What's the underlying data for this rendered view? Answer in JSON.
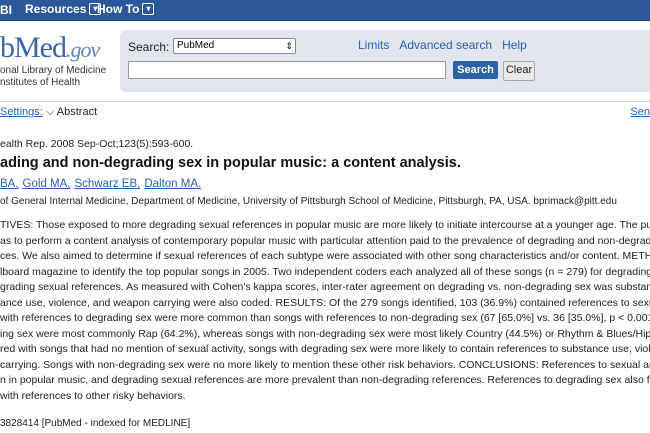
{
  "topbar": {
    "ncbi_label": "BI",
    "menus": [
      "Resources",
      "How To"
    ]
  },
  "logo": {
    "main": "bMed",
    "gov": ".gov",
    "line1": "onal Library of Medicine",
    "line2": "nstitutes of Health"
  },
  "search": {
    "label": "Search:",
    "database": "PubMed",
    "links": [
      "Limits",
      "Advanced search",
      "Help"
    ],
    "search_button": "Search",
    "clear_button": "Clear",
    "query_value": ""
  },
  "display": {
    "settings_label": "Settings:",
    "format": "Abstract",
    "send_label": "Sen"
  },
  "article": {
    "journal_line": "ealth Rep. 2008 Sep-Oct;123(5):593-600.",
    "title": "ading and non-degrading sex in popular music: a content analysis.",
    "authors": [
      "BA,",
      "Gold MA,",
      "Schwarz EB,",
      "Dalton MA."
    ],
    "affiliation": "of General Internal Medicine, Department of Medicine, University of Pittsburgh School of Medicine, Pittsburgh, PA, USA. bprimack@pitt.edu",
    "abstract_lines": [
      "TIVES: Those exposed to more degrading sexual references in popular music are more likely to initiate intercourse at a younger age. The purpos",
      "as to perform a content analysis of contemporary popular music with particular attention paid to the prevalence of degrading and non-degrading s",
      "ces. We also aimed to determine if sexual references of each subtype were associated with other song characteristics and/or content. METHODS",
      "lboard magazine to identify the top popular songs in 2005. Two independent coders each analyzed all of these songs (n = 279) for degrading and",
      "grading sexual references. As measured with Cohen's kappa scores, inter-rater agreement on degrading vs. non-degrading sex was substantial. M",
      "ance use, violence, and weapon carrying were also coded. RESULTS: Of the 279 songs identified, 103 (36.9%) contained references to sexual a",
      "with references to degrading sex were more common than songs with references to non-degrading sex (67 [65.0%] vs. 36 [35.0%], p < 0.001). So",
      "ing sex were most commonly Rap (64.2%), whereas songs with non-degrading sex were most likely Country (44.5%) or Rhythm & Blues/Hip-Hop",
      "red with songs that had no mention of sexual activity, songs with degrading sex were more likely to contain references to substance use, violence",
      "carrying. Songs with non-degrading sex were no more likely to mention these other risk behaviors. CONCLUSIONS: References to sexual activit",
      "n in popular music, and degrading sexual references are more prevalent than non-degrading references. References to degrading sex also freque",
      "with references to other risky behaviors."
    ],
    "pmid_line": "3828414 [PubMed - indexed for MEDLINE]"
  }
}
